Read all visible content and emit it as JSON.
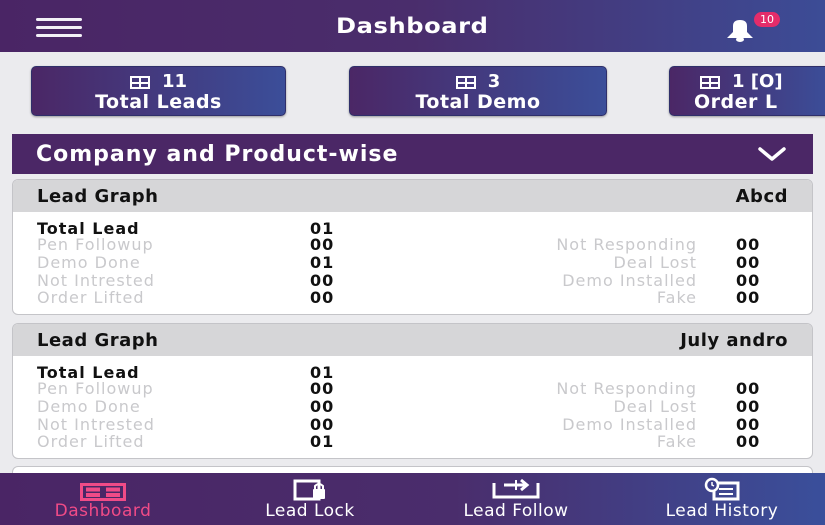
{
  "header": {
    "title": "Dashboard",
    "notification_count": "10"
  },
  "stats": [
    {
      "count": "11",
      "label": "Total Leads"
    },
    {
      "count": "3",
      "label": "Total Demo"
    },
    {
      "count": "1 [O]",
      "label": "Order L"
    }
  ],
  "company_selector": {
    "label": "Company and Product-wise"
  },
  "cards": [
    {
      "title": "Lead Graph",
      "product": "Abcd",
      "total_label": "Total Lead",
      "total_value": "01",
      "left": [
        {
          "label": "Pen Followup",
          "value": "00"
        },
        {
          "label": "Demo Done",
          "value": "01"
        },
        {
          "label": "Not Intrested",
          "value": "00"
        },
        {
          "label": "Order Lifted",
          "value": "00"
        }
      ],
      "right": [
        {
          "label": "Not Responding",
          "value": "00"
        },
        {
          "label": "Deal Lost",
          "value": "00"
        },
        {
          "label": "Demo Installed",
          "value": "00"
        },
        {
          "label": "Fake",
          "value": "00"
        }
      ]
    },
    {
      "title": "Lead Graph",
      "product": "July andro",
      "total_label": "Total Lead",
      "total_value": "01",
      "left": [
        {
          "label": "Pen Followup",
          "value": "00"
        },
        {
          "label": "Demo Done",
          "value": "00"
        },
        {
          "label": "Not Intrested",
          "value": "00"
        },
        {
          "label": "Order Lifted",
          "value": "01"
        }
      ],
      "right": [
        {
          "label": "Not Responding",
          "value": "00"
        },
        {
          "label": "Deal Lost",
          "value": "00"
        },
        {
          "label": "Demo Installed",
          "value": "00"
        },
        {
          "label": "Fake",
          "value": "00"
        }
      ]
    }
  ],
  "bottom_nav": [
    {
      "label": "Dashboard",
      "icon": "grid-icon",
      "active": true
    },
    {
      "label": "Lead Lock",
      "icon": "lock-icon",
      "active": false
    },
    {
      "label": "Lead Follow",
      "icon": "transfer-icon",
      "active": false
    },
    {
      "label": "Lead History",
      "icon": "history-icon",
      "active": false
    }
  ],
  "colors": {
    "primary": "#4b2766",
    "accent": "#3b4e99",
    "active_tab": "#f04b87",
    "badge": "#e42c6a"
  }
}
